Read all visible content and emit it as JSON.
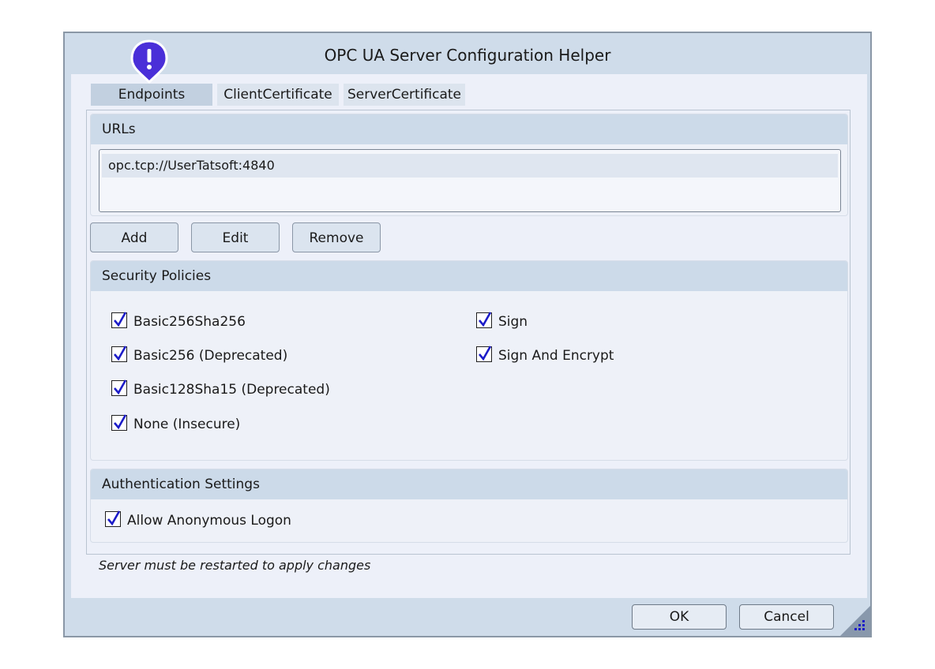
{
  "window": {
    "title": "OPC UA Server Configuration Helper"
  },
  "tabs": [
    {
      "label": "Endpoints",
      "active": true
    },
    {
      "label": "ClientCertificate",
      "active": false
    },
    {
      "label": "ServerCertificate",
      "active": false
    }
  ],
  "urls": {
    "header": "URLs",
    "items": [
      "opc.tcp://UserTatsoft:4840"
    ]
  },
  "url_buttons": {
    "add": "Add",
    "edit": "Edit",
    "remove": "Remove"
  },
  "security": {
    "header": "Security Policies",
    "policies": [
      {
        "label": "Basic256Sha256",
        "checked": true
      },
      {
        "label": "Basic256 (Deprecated)",
        "checked": true
      },
      {
        "label": "Basic128Sha15 (Deprecated)",
        "checked": true
      },
      {
        "label": "None (Insecure)",
        "checked": true
      }
    ],
    "modes": [
      {
        "label": "Sign",
        "checked": true
      },
      {
        "label": "Sign And Encrypt",
        "checked": true
      }
    ]
  },
  "authentication": {
    "header": "Authentication Settings",
    "allow_anonymous": {
      "label": "Allow Anonymous Logon",
      "checked": true
    }
  },
  "note": "Server must be restarted to apply changes",
  "footer": {
    "ok": "OK",
    "cancel": "Cancel"
  },
  "colors": {
    "accent": "#4a2fd8",
    "check": "#1c1cc8"
  },
  "icons": {
    "alert_pin": "exclamation-pin-icon",
    "grip": "resize-grip-icon"
  }
}
